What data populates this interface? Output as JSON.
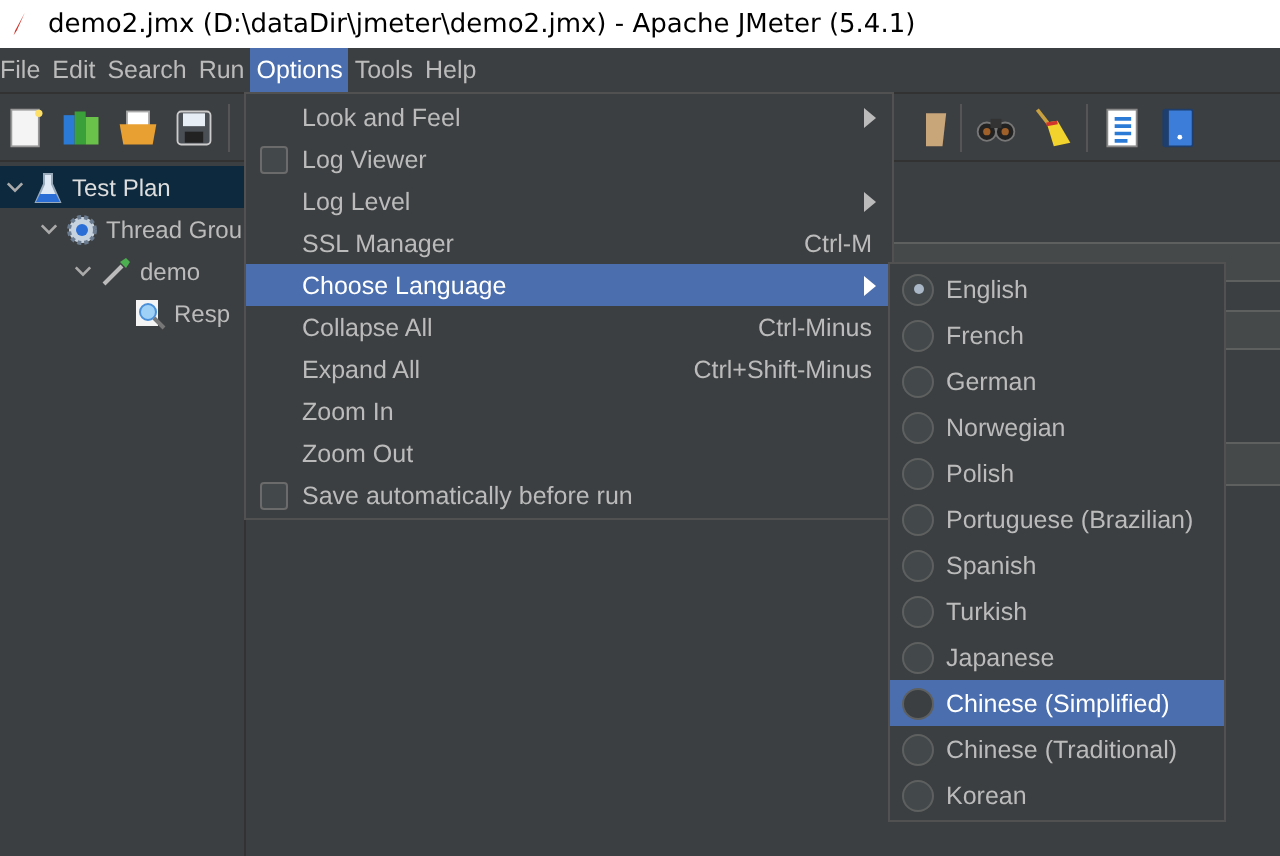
{
  "window": {
    "title": "demo2.jmx (D:\\dataDir\\jmeter\\demo2.jmx) - Apache JMeter (5.4.1)"
  },
  "menubar": [
    {
      "label": "File",
      "selected": false
    },
    {
      "label": "Edit",
      "selected": false
    },
    {
      "label": "Search",
      "selected": false
    },
    {
      "label": "Run",
      "selected": false
    },
    {
      "label": "Options",
      "selected": true
    },
    {
      "label": "Tools",
      "selected": false
    },
    {
      "label": "Help",
      "selected": false
    }
  ],
  "tree": [
    {
      "label": "Test Plan",
      "selected": true,
      "expanded": true,
      "children": [
        {
          "label": "Thread Grou",
          "selected": false,
          "expanded": true,
          "children": [
            {
              "label": "demo",
              "selected": false,
              "expanded": true,
              "children": [
                {
                  "label": "Resp",
                  "selected": false
                }
              ]
            }
          ]
        }
      ]
    }
  ],
  "options_menu": [
    {
      "kind": "submenu",
      "label": "Look and Feel",
      "highlighted": false
    },
    {
      "kind": "checkbox",
      "label": "Log Viewer",
      "checked": false,
      "highlighted": false
    },
    {
      "kind": "submenu",
      "label": "Log Level",
      "highlighted": false
    },
    {
      "kind": "item",
      "label": "SSL Manager",
      "shortcut": "Ctrl-M",
      "highlighted": false
    },
    {
      "kind": "submenu",
      "label": "Choose Language",
      "highlighted": true
    },
    {
      "kind": "item",
      "label": "Collapse All",
      "shortcut": "Ctrl-Minus",
      "highlighted": false
    },
    {
      "kind": "item",
      "label": "Expand All",
      "shortcut": "Ctrl+Shift-Minus",
      "highlighted": false
    },
    {
      "kind": "item",
      "label": "Zoom In",
      "highlighted": false
    },
    {
      "kind": "item",
      "label": "Zoom Out",
      "highlighted": false
    },
    {
      "kind": "checkbox",
      "label": "Save automatically before run",
      "checked": false,
      "highlighted": false
    }
  ],
  "language_menu": [
    {
      "label": "English",
      "selected": true,
      "highlighted": false
    },
    {
      "label": "French",
      "selected": false,
      "highlighted": false
    },
    {
      "label": "German",
      "selected": false,
      "highlighted": false
    },
    {
      "label": "Norwegian",
      "selected": false,
      "highlighted": false
    },
    {
      "label": "Polish",
      "selected": false,
      "highlighted": false
    },
    {
      "label": "Portuguese (Brazilian)",
      "selected": false,
      "highlighted": false
    },
    {
      "label": "Spanish",
      "selected": false,
      "highlighted": false
    },
    {
      "label": "Turkish",
      "selected": false,
      "highlighted": false
    },
    {
      "label": "Japanese",
      "selected": false,
      "highlighted": false
    },
    {
      "label": "Chinese (Simplified)",
      "selected": false,
      "highlighted": true
    },
    {
      "label": "Chinese (Traditional)",
      "selected": false,
      "highlighted": false
    },
    {
      "label": "Korean",
      "selected": false,
      "highlighted": false
    }
  ]
}
